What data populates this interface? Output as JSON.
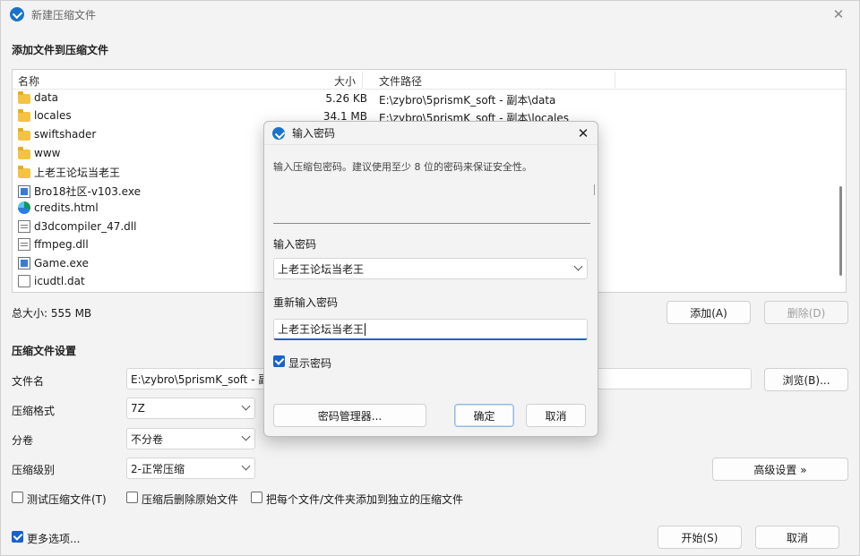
{
  "window": {
    "title": "新建压缩文件",
    "close": "✕"
  },
  "add_section": {
    "title": "添加文件到压缩文件"
  },
  "file_list": {
    "columns": {
      "name": "名称",
      "size": "大小",
      "path": "文件路径"
    },
    "rows": [
      {
        "icon": "folder-icon",
        "name": "data",
        "size": "5.26 KB",
        "path": "E:\\zybro\\5prismK_soft - 副本\\data"
      },
      {
        "icon": "folder-icon",
        "name": "locales",
        "size": "34.1 MB",
        "path": "E:\\zybro\\5prismK_soft - 副本\\locales"
      },
      {
        "icon": "folder-icon",
        "name": "swiftshader",
        "size": "",
        "path": ""
      },
      {
        "icon": "folder-icon",
        "name": "www",
        "size": "",
        "path": ""
      },
      {
        "icon": "folder-icon",
        "name": "上老王论坛当老王",
        "size": "",
        "path": ""
      },
      {
        "icon": "exe-icon",
        "name": "Bro18社区-v103.exe",
        "size": "",
        "path": ""
      },
      {
        "icon": "html-icon",
        "name": "credits.html",
        "size": "",
        "path": ""
      },
      {
        "icon": "dll-icon",
        "name": "d3dcompiler_47.dll",
        "size": "",
        "path": ""
      },
      {
        "icon": "dll-icon",
        "name": "ffmpeg.dll",
        "size": "",
        "path": ""
      },
      {
        "icon": "exe-icon",
        "name": "Game.exe",
        "size": "",
        "path": ""
      },
      {
        "icon": "file-icon",
        "name": "icudtl.dat",
        "size": "",
        "path": ""
      }
    ]
  },
  "summary": {
    "total_size": "总大小: 555 MB",
    "add_button": "添加(A)",
    "delete_button": "删除(D)"
  },
  "settings": {
    "title": "压缩文件设置",
    "filename_label": "文件名",
    "filename_value": "E:\\zybro\\5prismK_soft - 副",
    "browse_button": "浏览(B)...",
    "format_label": "压缩格式",
    "format_value": "7Z",
    "split_label": "分卷",
    "split_value": "不分卷",
    "level_label": "压缩级别",
    "level_value": "2-正常压缩",
    "advanced_button": "高级设置 »",
    "test_checkbox": "测试压缩文件(T)",
    "delete_after_checkbox": "压缩后删除原始文件",
    "separate_checkbox": "把每个文件/文件夹添加到独立的压缩文件"
  },
  "footer": {
    "more_options": "更多选项...",
    "start_button": "开始(S)",
    "cancel_button": "取消"
  },
  "dialog": {
    "title": "输入密码",
    "description": "输入压缩包密码。建议使用至少 8 位的密码来保证安全性。",
    "password_label": "输入密码",
    "password_value": "上老王论坛当老王",
    "reenter_label": "重新输入密码",
    "reenter_value": "上老王论坛当老王",
    "show_password": "显示密码",
    "manager_button": "密码管理器...",
    "ok_button": "确定",
    "cancel_button": "取消",
    "close": "✕"
  },
  "colors": {
    "accent": "#1a62c9",
    "folder": "#f5c342",
    "window_bg": "#f3f3f3"
  }
}
